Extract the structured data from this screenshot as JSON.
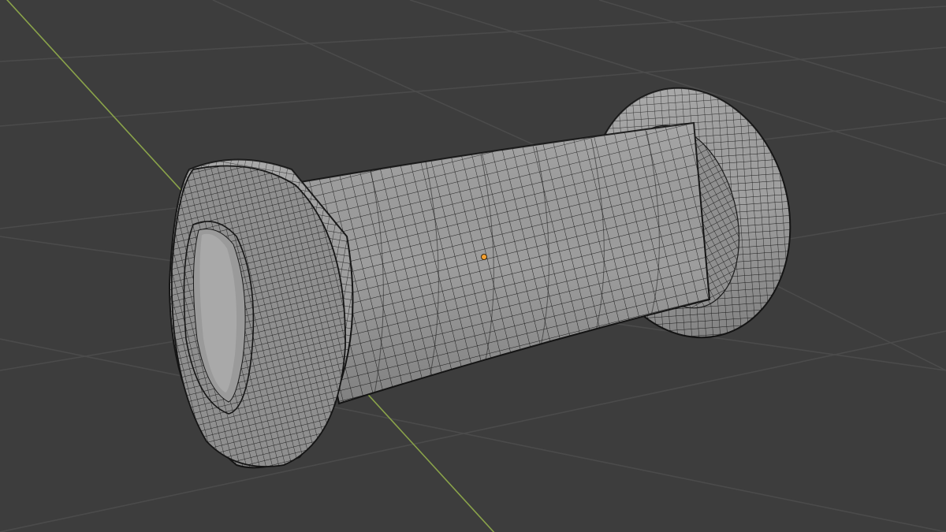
{
  "viewport": {
    "view": "3d-viewport",
    "shading": "solid-wireframe-overlay",
    "object": "spool-mesh",
    "colors": {
      "background": "#3d3d3d",
      "grid_line": "#4b4b4b",
      "y_axis": "#8aa34a",
      "mesh_face": "#9c9c9c",
      "mesh_face_dark": "#6e6e6e",
      "mesh_wire": "#1a1a1a",
      "origin": "#f5a030"
    },
    "icons": [
      "origin-point-icon"
    ]
  }
}
